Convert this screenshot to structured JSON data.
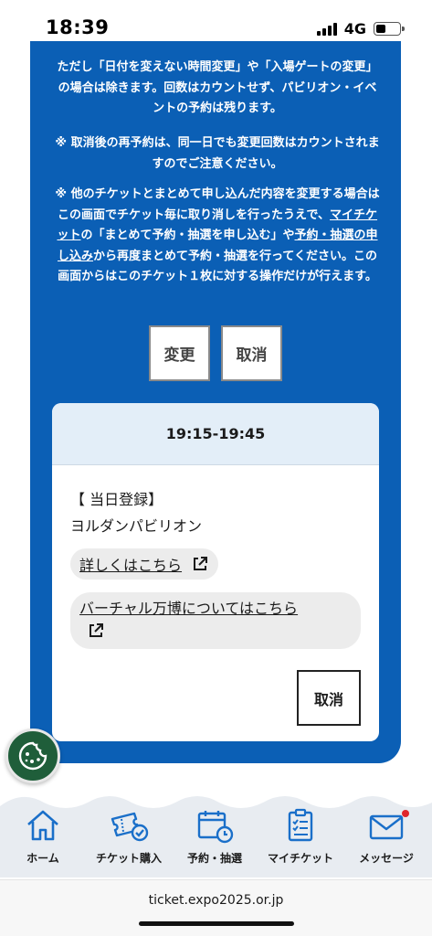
{
  "status_bar": {
    "time": "18:39",
    "network": "4G"
  },
  "notice": {
    "p1": "ただし「日付を変えない時間変更」や「入場ゲートの変更」の場合は除きます。回数はカウントせず、パビリオン・イベントの予約は残ります。",
    "p2": "※ 取消後の再予約は、同一日でも変更回数はカウントされますのでご注意ください。",
    "p3_a": "※ 他のチケットとまとめて申し込んだ内容を変更する場合はこの画面でチケット毎に取り消しを行ったうえで、",
    "p3_link1": "マイチケット",
    "p3_b": "の「まとめて予約・抽選を申し込む」や",
    "p3_link2": "予約・抽選の申し込み",
    "p3_c": "から再度まとめて予約・抽選を行ってください。この画面からはこのチケット１枚に対する操作だけが行えます。"
  },
  "actions": {
    "change": "変更",
    "cancel": "取消"
  },
  "reservation": {
    "time_slot": "19:15-19:45",
    "entry_type": "【 当日登録】",
    "pavilion": "ヨルダンパビリオン",
    "details_link": "詳しくはこちら",
    "virtual_link": "バーチャル万博についてはこちら",
    "cancel": "取消"
  },
  "nav": {
    "items": [
      {
        "label": "ホーム",
        "icon": "home-icon"
      },
      {
        "label": "チケット購入",
        "icon": "ticket-icon"
      },
      {
        "label": "予約・抽選",
        "icon": "calendar-icon"
      },
      {
        "label": "マイチケット",
        "icon": "clipboard-icon"
      },
      {
        "label": "メッセージ",
        "icon": "mail-icon"
      }
    ]
  },
  "browser": {
    "url": "ticket.expo2025.or.jp"
  },
  "colors": {
    "primary_blue": "#0b5fb5",
    "notification_red": "#e0262b",
    "cookie_green": "#1f5e3a"
  }
}
